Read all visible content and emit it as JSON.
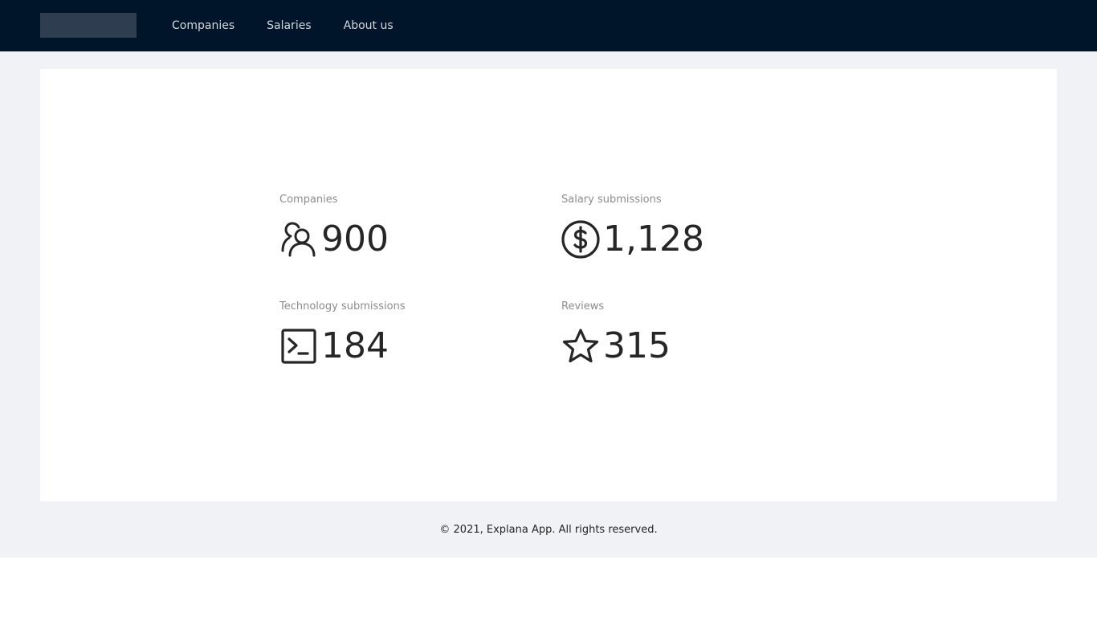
{
  "nav": {
    "items": [
      {
        "label": "Companies"
      },
      {
        "label": "Salaries"
      },
      {
        "label": "About us"
      }
    ]
  },
  "stats": {
    "companies": {
      "label": "Companies",
      "value": "900",
      "icon": "team-icon"
    },
    "salaries": {
      "label": "Salary submissions",
      "value": "1,128",
      "icon": "dollar-circle-icon"
    },
    "technology": {
      "label": "Technology submissions",
      "value": "184",
      "icon": "terminal-icon"
    },
    "reviews": {
      "label": "Reviews",
      "value": "315",
      "icon": "star-icon"
    }
  },
  "footer": {
    "text": "© 2021, Explana App. All rights reserved."
  },
  "colors": {
    "header_bg": "#001529",
    "page_bg": "#f0f2f5",
    "text_primary": "#262626",
    "text_secondary": "#8c8c8c"
  }
}
